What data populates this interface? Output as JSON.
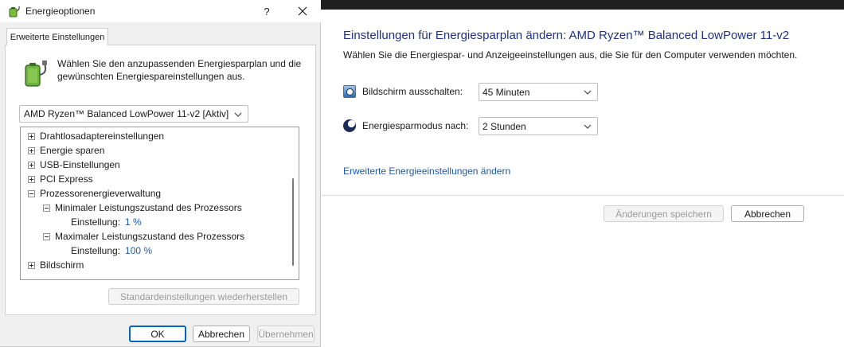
{
  "background_window": {
    "heading": "Einstellungen für Energiesparplan ändern: AMD Ryzen™ Balanced LowPower 11-v2",
    "description": "Wählen Sie die Energiespar- und Anzeigeeinstellungen aus, die Sie für den Computer verwenden möchten.",
    "display_off_label": "Bildschirm ausschalten:",
    "display_off_value": "45 Minuten",
    "sleep_label": "Energiesparmodus nach:",
    "sleep_value": "2 Stunden",
    "advanced_link": "Erweiterte Energieeinstellungen ändern",
    "save_button": "Änderungen speichern",
    "cancel_button": "Abbrechen"
  },
  "dialog": {
    "title": "Energieoptionen",
    "help": "?",
    "tab": "Erweiterte Einstellungen",
    "intro": "Wählen Sie den anzupassenden Energiesparplan und die gewünschten Energiespareinstellungen aus.",
    "plan_selected": "AMD Ryzen™ Balanced LowPower 11-v2 [Aktiv]",
    "tree": {
      "wireless": "Drahtlosadaptereinstellungen",
      "energy_saving": "Energie sparen",
      "usb": "USB-Einstellungen",
      "pci": "PCI Express",
      "processor": "Prozessorenergieverwaltung",
      "min_state": "Minimaler Leistungszustand des Prozessors",
      "min_setting_label": "Einstellung:",
      "min_setting_value": "1 %",
      "max_state": "Maximaler Leistungszustand des Prozessors",
      "max_setting_label": "Einstellung:",
      "max_setting_value": "100 %",
      "display": "Bildschirm"
    },
    "restore_button": "Standardeinstellungen wiederherstellen",
    "ok_button": "OK",
    "cancel_button": "Abbrechen",
    "apply_button": "Übernehmen"
  },
  "colors": {
    "heading_blue": "#1e3287",
    "link_blue": "#1e5aa8",
    "focus_blue": "#0067c0"
  },
  "icons": [
    "power-options-icon",
    "help-icon",
    "close-icon",
    "battery-plug-icon",
    "chevron-down-icon",
    "monitor-icon",
    "moon-icon",
    "expand-icon",
    "collapse-icon"
  ]
}
